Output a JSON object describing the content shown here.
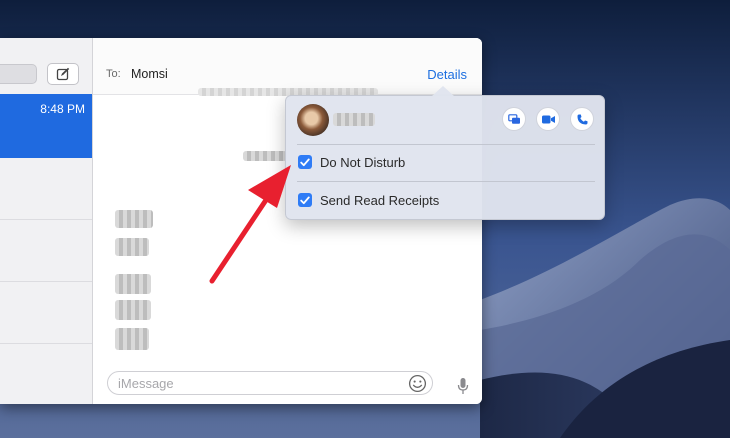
{
  "window": {
    "conversations": [
      {
        "time": "8:48 PM",
        "selected": true
      }
    ]
  },
  "header": {
    "to_label": "To:",
    "recipient": "Momsi",
    "details_label": "Details"
  },
  "composer": {
    "placeholder": "iMessage"
  },
  "popover": {
    "options": [
      {
        "label": "Do Not Disturb",
        "checked": true
      },
      {
        "label": "Send Read Receipts",
        "checked": true
      }
    ],
    "actions": [
      "screen-share-icon",
      "video-camera-icon",
      "phone-icon"
    ]
  },
  "colors": {
    "accent": "#1f6ae0",
    "checkbox": "#2f7cf6",
    "arrow": "#e8202f",
    "link": "#1d6fe0"
  }
}
